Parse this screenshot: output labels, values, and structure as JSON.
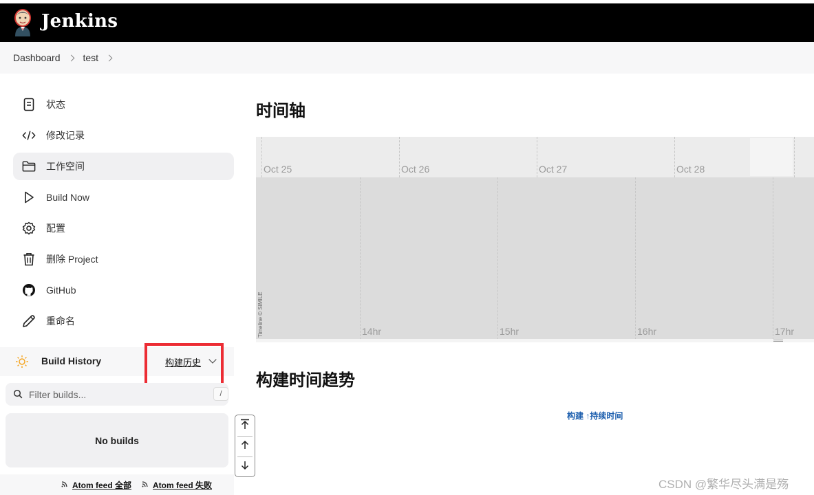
{
  "header": {
    "brand": "Jenkins"
  },
  "breadcrumb": {
    "items": [
      "Dashboard",
      "test"
    ]
  },
  "sidebar": {
    "items": [
      {
        "label": "状态",
        "icon": "document-icon"
      },
      {
        "label": "修改记录",
        "icon": "code-icon"
      },
      {
        "label": "工作空间",
        "icon": "folder-icon",
        "active": true
      },
      {
        "label": "Build Now",
        "icon": "play-icon"
      },
      {
        "label": "配置",
        "icon": "gear-icon"
      },
      {
        "label": "删除 Project",
        "icon": "trash-icon"
      },
      {
        "label": "GitHub",
        "icon": "github-icon"
      },
      {
        "label": "重命名",
        "icon": "pencil-icon"
      }
    ]
  },
  "build_history": {
    "title": "Build History",
    "trend_link": "构建历史",
    "filter_placeholder": "Filter builds...",
    "filter_shortcut": "/",
    "empty_text": "No builds",
    "feeds": {
      "all": "Atom feed 全部",
      "failures": "Atom feed 失败"
    }
  },
  "main": {
    "timeline_title": "时间轴",
    "timeline": {
      "day_labels": [
        "Oct 25",
        "Oct 26",
        "Oct 27",
        "Oct 28"
      ],
      "hour_labels": [
        "14hr",
        "15hr",
        "16hr",
        "17hr"
      ],
      "credit": "Timeline © SIMILE"
    },
    "trend_title": "构建时间趋势",
    "trend_legend": "构建 ↑持续时间"
  },
  "watermark": "CSDN @繁华尽头满是殇",
  "colors": {
    "header_bg": "#000000",
    "highlight_border": "#ec2c34",
    "link_blue": "#1d5fae",
    "active_item_bg": "#f0f0f2"
  }
}
